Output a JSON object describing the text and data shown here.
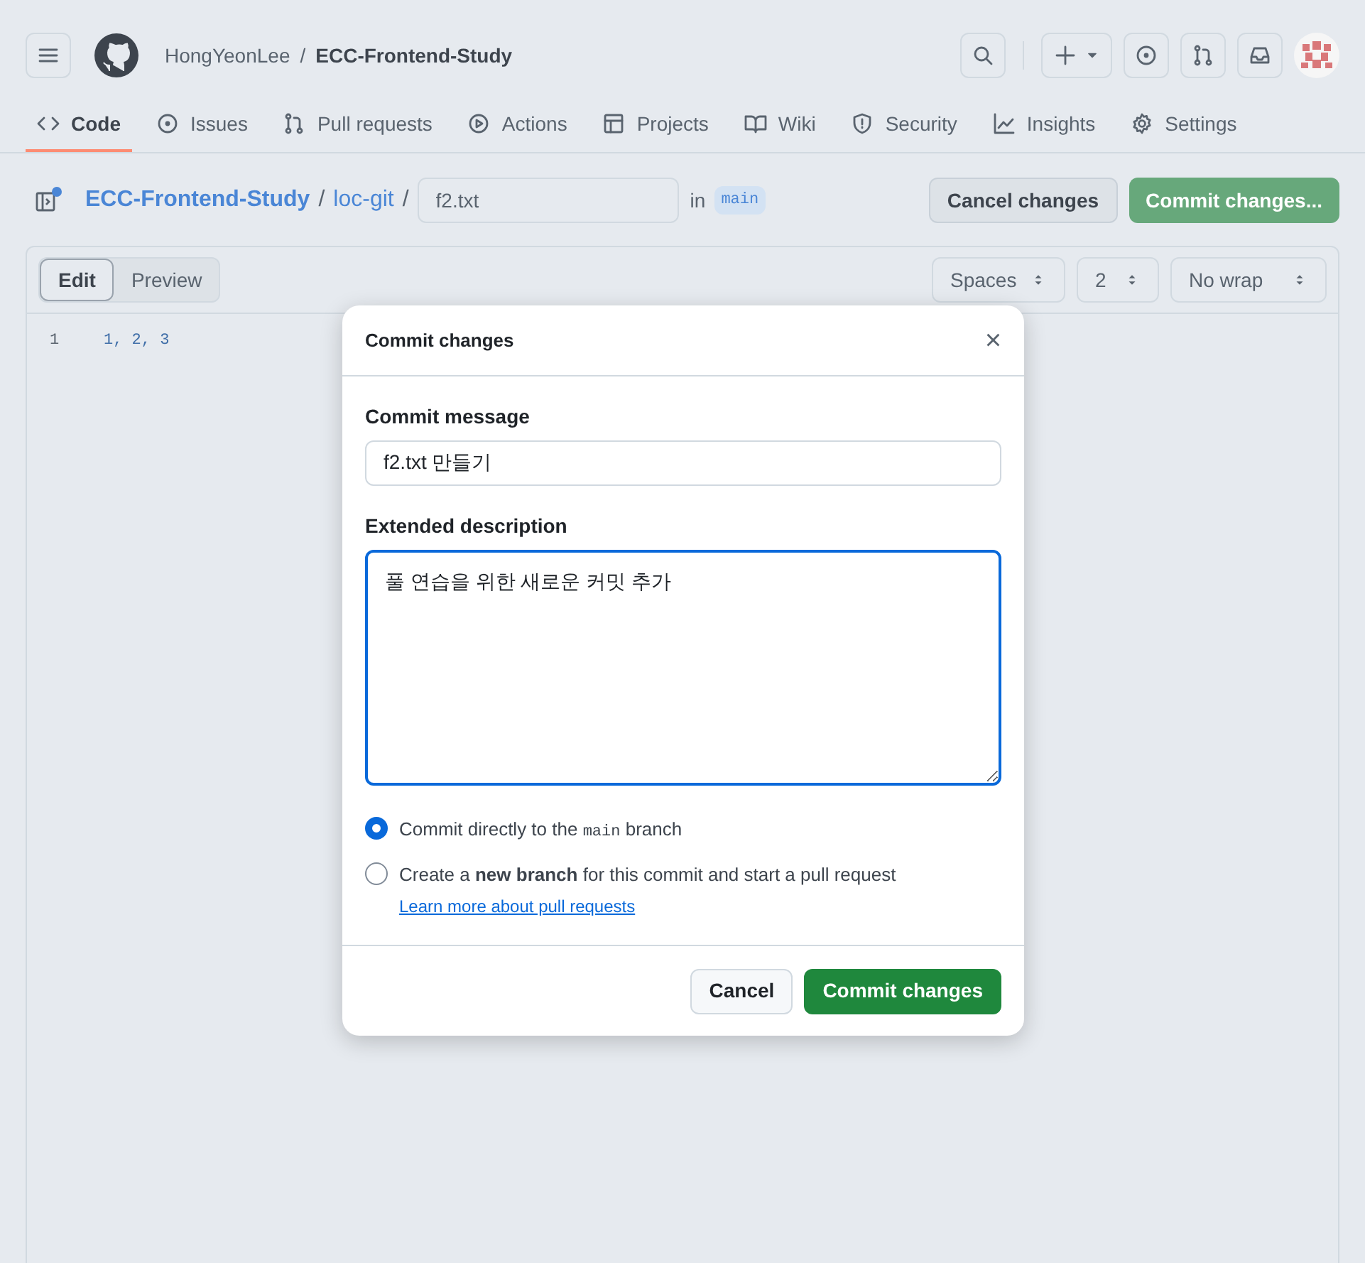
{
  "header": {
    "owner": "HongYeonLee",
    "separator": "/",
    "repo": "ECC-Frontend-Study"
  },
  "tabs": [
    {
      "label": "Code",
      "selected": true
    },
    {
      "label": "Issues",
      "selected": false
    },
    {
      "label": "Pull requests",
      "selected": false
    },
    {
      "label": "Actions",
      "selected": false
    },
    {
      "label": "Projects",
      "selected": false
    },
    {
      "label": "Wiki",
      "selected": false
    },
    {
      "label": "Security",
      "selected": false
    },
    {
      "label": "Insights",
      "selected": false
    },
    {
      "label": "Settings",
      "selected": false
    }
  ],
  "breadcrumb": {
    "repo": "ECC-Frontend-Study",
    "sep1": "/",
    "folder": "loc-git",
    "sep2": "/",
    "filename": "f2.txt",
    "in": "in",
    "branch": "main"
  },
  "actions": {
    "cancel": "Cancel changes",
    "commit": "Commit changes..."
  },
  "editor": {
    "modes": [
      {
        "label": "Edit",
        "selected": true
      },
      {
        "label": "Preview",
        "selected": false
      }
    ],
    "selects": [
      "Spaces",
      "2",
      "No wrap"
    ],
    "lines": [
      {
        "number": "1",
        "text": "1, 2, 3"
      }
    ]
  },
  "dialog": {
    "title": "Commit changes",
    "close": "×",
    "message_label": "Commit message",
    "message_value": "f2.txt 만들기",
    "description_label": "Extended description",
    "description_value": "풀 연습을 위한 새로운 커밋 추가",
    "options": [
      {
        "kind": "direct",
        "selected": true,
        "before": "Commit directly to the ",
        "code": "main",
        "after": " branch"
      },
      {
        "kind": "new_branch",
        "selected": false,
        "text": "Create a **new branch** for this commit and start a pull request ",
        "link": "Learn more about pull requests"
      }
    ],
    "buttons": {
      "cancel": "Cancel",
      "commit": "Commit changes"
    }
  }
}
